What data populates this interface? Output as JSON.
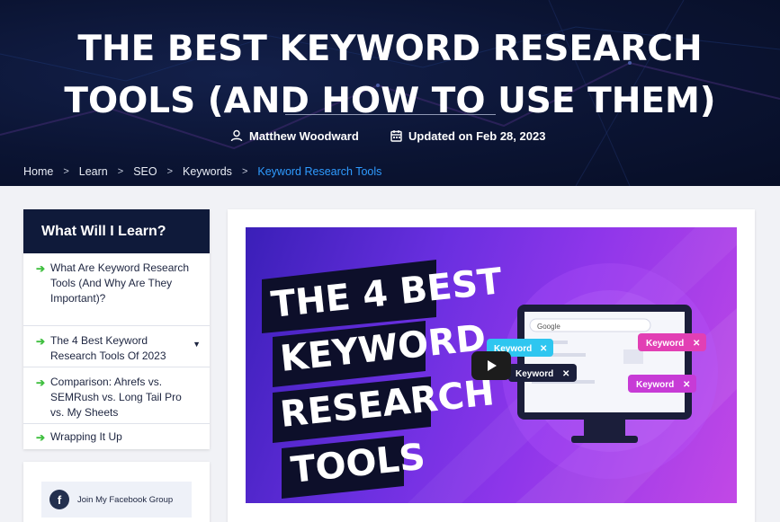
{
  "hero": {
    "title_line1": "THE BEST KEYWORD RESEARCH",
    "title_line2": "TOOLS (AND HOW TO USE THEM)",
    "author": "Matthew Woodward",
    "updated": "Updated on Feb 28, 2023"
  },
  "breadcrumb": {
    "items": [
      "Home",
      "Learn",
      "SEO",
      "Keywords"
    ],
    "current": "Keyword Research Tools",
    "separator": ">"
  },
  "toc": {
    "title": "What Will I Learn?",
    "items": [
      {
        "label": "What Are Keyword Research Tools (And Why Are They Important)?"
      },
      {
        "label": "The 4 Best Keyword Research Tools Of 2023"
      },
      {
        "label": "Comparison: Ahrefs vs. SEMRush vs. Long Tail Pro vs. My Sheets"
      },
      {
        "label": "Wrapping It Up"
      }
    ],
    "arrow_icon": "arrow-right-icon"
  },
  "social": {
    "facebook_label": "Join My Facebook Group",
    "facebook_icon": "f"
  },
  "video": {
    "thumb_lines": [
      "THE 4 BEST",
      "KEYWORD",
      "RESEARCH",
      "TOOLS"
    ],
    "browser_brand": "Google",
    "chips": [
      "Keyword",
      "Keyword",
      "Keyword",
      "Keyword"
    ],
    "play_icon": "play-icon"
  },
  "colors": {
    "hero_bg": "#0b1433",
    "accent_link": "#2f9bff",
    "toc_header": "#0f1a3a",
    "arrow": "#3fbf3f",
    "chip_blue": "#2ec6f0",
    "chip_pink": "#e23fb4",
    "chip_dark": "#1b1f3b",
    "chip_purple": "#c73bd6"
  }
}
